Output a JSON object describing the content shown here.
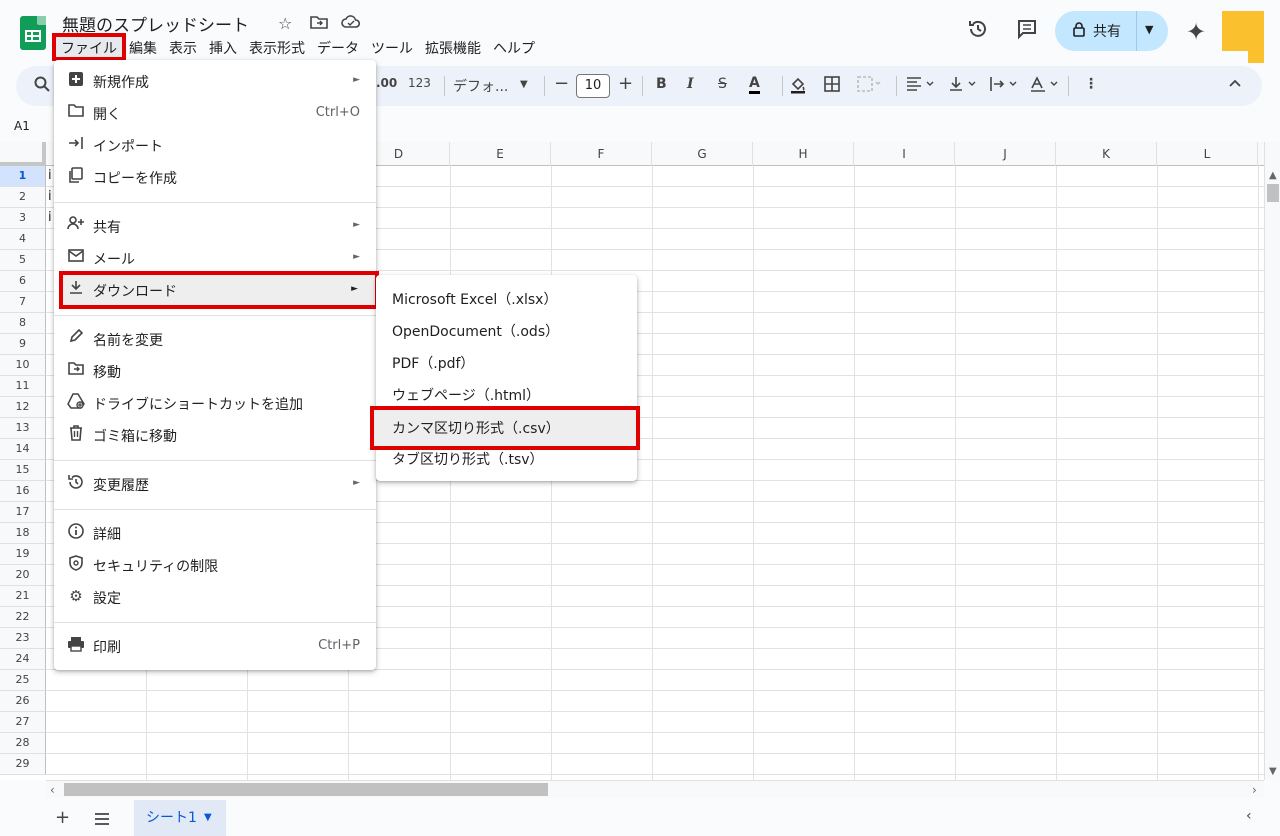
{
  "header": {
    "doc_title": "無題のスプレッドシート",
    "share_label": "共有"
  },
  "menubar": {
    "items": [
      "ファイル",
      "編集",
      "表示",
      "挿入",
      "表示形式",
      "データ",
      "ツール",
      "拡張機能",
      "ヘルプ"
    ]
  },
  "toolbar": {
    "decimal_label": ".00",
    "number_format_label": "123",
    "font_label": "デフォ...",
    "font_size": "10",
    "minus_label": "−",
    "plus_label": "+"
  },
  "name_box": "A1",
  "grid": {
    "columns": [
      "D",
      "E",
      "F",
      "G",
      "H",
      "I",
      "J",
      "K",
      "L"
    ],
    "rows": [
      "1",
      "2",
      "3",
      "4",
      "5",
      "6",
      "7",
      "8",
      "9",
      "10",
      "11",
      "12",
      "13",
      "14",
      "15",
      "16",
      "17",
      "18",
      "19",
      "20",
      "21",
      "22",
      "23",
      "24",
      "25",
      "26",
      "27",
      "28",
      "29"
    ],
    "cell_fragments": [
      "i",
      "i",
      "i"
    ]
  },
  "file_menu": {
    "new": "新規作成",
    "open": "開く",
    "open_shortcut": "Ctrl+O",
    "import": "インポート",
    "copy": "コピーを作成",
    "share": "共有",
    "email": "メール",
    "download": "ダウンロード",
    "rename": "名前を変更",
    "move": "移動",
    "shortcut": "ドライブにショートカットを追加",
    "trash": "ゴミ箱に移動",
    "history": "変更履歴",
    "details": "詳細",
    "security": "セキュリティの制限",
    "settings": "設定",
    "print": "印刷",
    "print_shortcut": "Ctrl+P"
  },
  "download_menu": {
    "xlsx": "Microsoft Excel（.xlsx）",
    "ods": "OpenDocument（.ods）",
    "pdf": "PDF（.pdf）",
    "html": "ウェブページ（.html）",
    "csv": "カンマ区切り形式（.csv）",
    "tsv": "タブ区切り形式（.tsv）"
  },
  "sheetbar": {
    "sheet_name": "シート1"
  },
  "colors": {
    "highlight_red": "#e00000",
    "share_bg": "#c2e7ff",
    "sheets_green": "#0f9d58"
  }
}
